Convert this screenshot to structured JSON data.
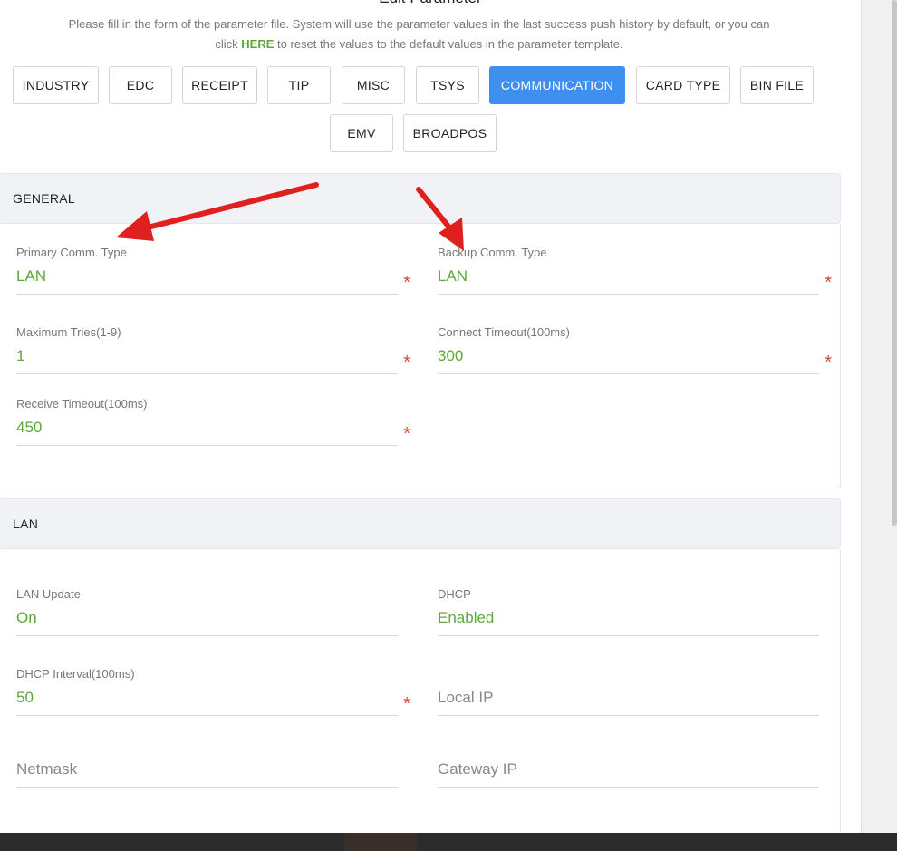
{
  "header": {
    "title": "Edit Parameter",
    "intro_line1": "Please fill in the form of the parameter file. System will use the parameter values in the last success push history by default, or you can",
    "intro_click": "click ",
    "intro_here": "HERE",
    "intro_rest": " to reset the values to the default values in the parameter template."
  },
  "tabs": [
    {
      "label": "INDUSTRY",
      "active": false
    },
    {
      "label": "EDC",
      "active": false
    },
    {
      "label": "RECEIPT",
      "active": false
    },
    {
      "label": "TIP",
      "active": false
    },
    {
      "label": "MISC",
      "active": false
    },
    {
      "label": "TSYS",
      "active": false
    },
    {
      "label": "COMMUNICATION",
      "active": true
    },
    {
      "label": "CARD TYPE",
      "active": false
    },
    {
      "label": "BIN FILE",
      "active": false
    },
    {
      "label": "EMV",
      "active": false
    },
    {
      "label": "BROADPOS",
      "active": false
    }
  ],
  "general": {
    "title": "GENERAL",
    "primary_comm": {
      "label": "Primary Comm. Type",
      "value": "LAN"
    },
    "backup_comm": {
      "label": "Backup Comm. Type",
      "value": "LAN"
    },
    "max_tries": {
      "label": "Maximum Tries(1-9)",
      "value": "1"
    },
    "connect_timeout": {
      "label": "Connect Timeout(100ms)",
      "value": "300"
    },
    "receive_timeout": {
      "label": "Receive Timeout(100ms)",
      "value": "450"
    }
  },
  "lan": {
    "title": "LAN",
    "lan_update": {
      "label": "LAN Update",
      "value": "On"
    },
    "dhcp": {
      "label": "DHCP",
      "value": "Enabled"
    },
    "dhcp_interval": {
      "label": "DHCP Interval(100ms)",
      "value": "50"
    },
    "local_ip": {
      "placeholder": "Local IP"
    },
    "netmask": {
      "placeholder": "Netmask"
    },
    "gateway_ip": {
      "placeholder": "Gateway IP"
    }
  },
  "required_mark": "*",
  "colors": {
    "accent": "#3d8ff0",
    "value_green": "#5aa93a",
    "required_red": "#d9453e",
    "annotation_arrow": "#e0201f"
  }
}
